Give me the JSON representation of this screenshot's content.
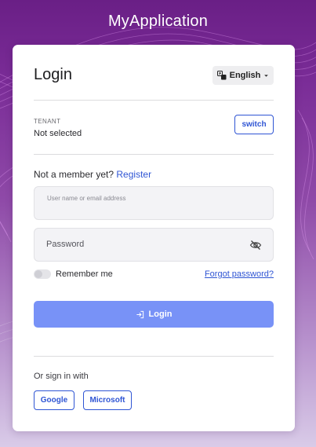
{
  "app": {
    "title": "MyApplication"
  },
  "login": {
    "title": "Login",
    "language": {
      "label": "English",
      "icon": "translate-icon",
      "chevron": "chevron-down-icon"
    },
    "tenant": {
      "label": "TENANT",
      "value": "Not selected",
      "switch_label": "switch"
    },
    "member": {
      "prompt": "Not a member yet?",
      "register_label": "Register"
    },
    "username": {
      "placeholder": "User name or email address",
      "value": ""
    },
    "password": {
      "placeholder": "Password",
      "value": "",
      "toggle_icon": "eye-slash-icon"
    },
    "remember": {
      "label": "Remember me",
      "checked": false
    },
    "forgot_label": "Forgot password?",
    "submit": {
      "label": "Login",
      "icon": "login-arrow-icon"
    },
    "social": {
      "prompt": "Or sign in with",
      "providers": [
        {
          "label": "Google"
        },
        {
          "label": "Microsoft"
        }
      ]
    }
  },
  "colors": {
    "accent": "#2f55d4",
    "primary_button": "#7892f7",
    "background_top": "#6a1f86",
    "background_bottom": "#d9cbe8"
  }
}
